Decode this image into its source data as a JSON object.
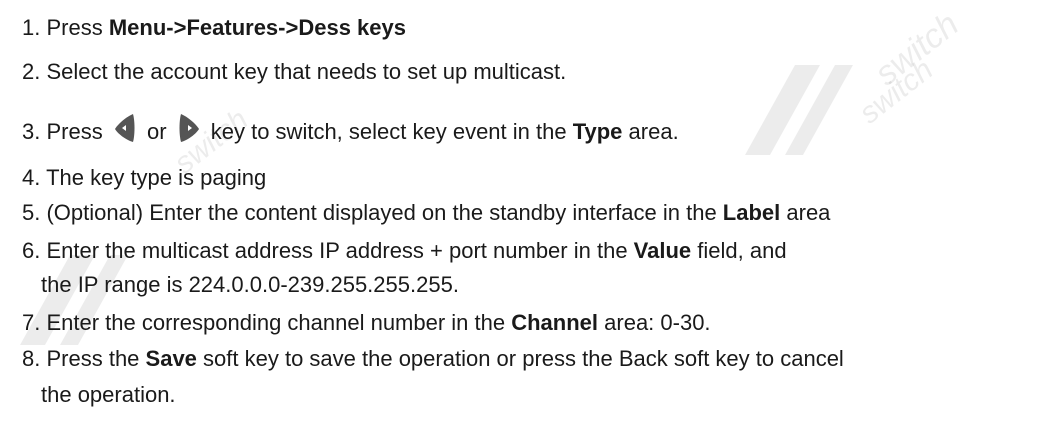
{
  "watermark": {
    "brand": "switch"
  },
  "steps": [
    {
      "number": "1.",
      "parts": [
        "Press ",
        "Menu->Features->Dess keys"
      ]
    },
    {
      "number": "2.",
      "parts": [
        "Select the account key that needs to set up multicast."
      ]
    },
    {
      "number": "3.",
      "parts": [
        "Press ",
        " or ",
        " key to switch, select key event in the ",
        "Type",
        " area."
      ],
      "icons": [
        "left-arrow-key-icon",
        "right-arrow-key-icon"
      ]
    },
    {
      "number": "4.",
      "parts": [
        "The key type is paging"
      ]
    },
    {
      "number": "5.",
      "parts": [
        "(Optional) Enter the content displayed on the standby interface in the ",
        "Label",
        " area"
      ]
    },
    {
      "number": "6.",
      "parts": [
        "Enter the multicast address IP address + port number in the ",
        "Value",
        " field, and"
      ],
      "continuation": "the IP range is 224.0.0.0-239.255.255.255."
    },
    {
      "number": "7.",
      "parts": [
        "Enter the corresponding channel number in the ",
        "Channel",
        " area: 0-30."
      ]
    },
    {
      "number": "8.",
      "parts": [
        "Press the ",
        "Save",
        " soft key to save the operation or press the Back soft key to cancel"
      ],
      "continuation": "the operation."
    }
  ],
  "colors": {
    "text": "#1a1a1a",
    "icon": "#555555",
    "background": "#ffffff"
  }
}
